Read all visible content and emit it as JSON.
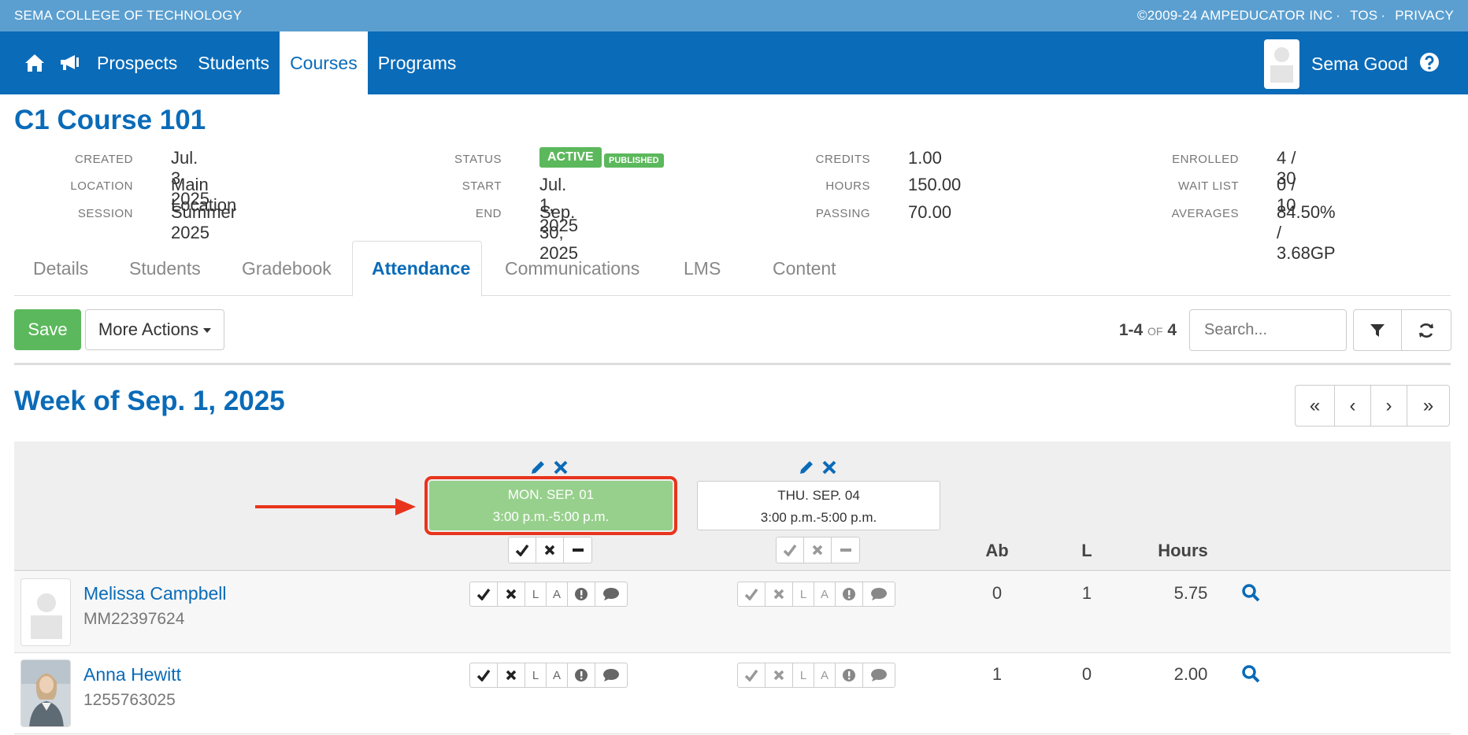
{
  "topbar": {
    "org": "SEMA COLLEGE OF TECHNOLOGY",
    "copyright": "©2009-24 AMPEDUCATOR INC",
    "sep": "·",
    "tos": "TOS",
    "privacy": "PRIVACY"
  },
  "nav": {
    "items": [
      "Prospects",
      "Students",
      "Courses",
      "Programs"
    ],
    "active": "Courses",
    "user": "Sema Good"
  },
  "course": {
    "title": "C1 Course 101",
    "created_label": "CREATED",
    "created": "Jul. 3, 2025",
    "location_label": "LOCATION",
    "location": "Main Location",
    "session_label": "SESSION",
    "session": "Summer 2025",
    "status_label": "STATUS",
    "status": "ACTIVE",
    "published": "PUBLISHED",
    "start_label": "START",
    "start": "Jul. 1, 2025",
    "end_label": "END",
    "end": "Sep. 30, 2025",
    "credits_label": "CREDITS",
    "credits": "1.00",
    "hours_label": "HOURS",
    "hours": "150.00",
    "passing_label": "PASSING",
    "passing": "70.00",
    "enrolled_label": "ENROLLED",
    "enrolled": "4 / 30",
    "waitlist_label": "WAIT LIST",
    "waitlist": "0 / 10",
    "averages_label": "AVERAGES",
    "averages": "84.50% / 3.68GP"
  },
  "tabs": [
    "Details",
    "Students",
    "Gradebook",
    "Attendance",
    "Communications",
    "LMS",
    "Content"
  ],
  "active_tab": "Attendance",
  "toolbar": {
    "save": "Save",
    "more_actions": "More Actions",
    "range": "1-4",
    "of": "OF",
    "total": "4",
    "search_placeholder": "Search..."
  },
  "week": {
    "title": "Week of Sep. 1, 2025"
  },
  "sessions": [
    {
      "day": "MON. SEP. 01",
      "time": "3:00 p.m.-5:00 p.m.",
      "selected": true
    },
    {
      "day": "THU. SEP. 04",
      "time": "3:00 p.m.-5:00 p.m.",
      "selected": false
    }
  ],
  "columns": {
    "absent": "Ab",
    "late": "L",
    "hours": "Hours"
  },
  "attendance_codes": {
    "late": "L",
    "absent": "A"
  },
  "students": [
    {
      "name": "Melissa Campbell",
      "id": "MM22397624",
      "ab": "0",
      "l": "1",
      "hours": "5.75",
      "photo": "placeholder"
    },
    {
      "name": "Anna Hewitt",
      "id": "1255763025",
      "ab": "1",
      "l": "0",
      "hours": "2.00",
      "photo": "portrait"
    }
  ],
  "colors": {
    "brand": "#0a6bb8",
    "topbar": "#5b9fd0",
    "success": "#5cb85c",
    "highlight": "#e8341c",
    "selected_session": "#97d08d"
  }
}
